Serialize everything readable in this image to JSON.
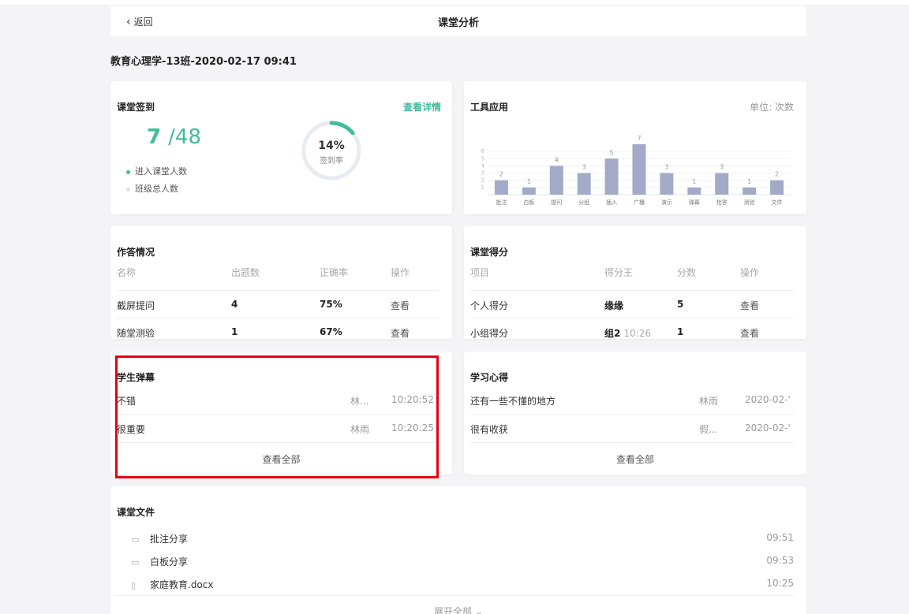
{
  "header": {
    "back_label": "返回",
    "title": "课堂分析"
  },
  "class_title": "教育心理学-13班-2020-02-17 09:41",
  "checkin": {
    "title": "课堂签到",
    "detail_link": "查看详情",
    "entered": "7",
    "total": "/48",
    "legend_entered": "进入课堂人数",
    "legend_total": "班级总人数",
    "rate": "14%",
    "rate_label": "签到率",
    "rate_fraction": 0.14,
    "colors": {
      "accent": "#3fbc9b",
      "track": "#e8ecf2"
    }
  },
  "tools": {
    "title": "工具应用",
    "unit": "单位: 次数",
    "chart_data": {
      "type": "bar",
      "categories": [
        "批注",
        "白板",
        "提问",
        "分组",
        "插入",
        "广播",
        "演示",
        "弹幕",
        "抢答",
        "测验",
        "文件"
      ],
      "values": [
        2,
        1,
        4,
        3,
        5,
        7,
        3,
        1,
        3,
        1,
        2
      ],
      "yticks": [
        1,
        2,
        3,
        4,
        5,
        6
      ],
      "ylim": [
        0,
        7
      ],
      "color": "#a3aac7",
      "grid": true
    }
  },
  "answers": {
    "title": "作答情况",
    "headers": [
      "名称",
      "出题数",
      "正确率",
      "操作"
    ],
    "rows": [
      {
        "name": "截屏提问",
        "count": "4",
        "rate": "75%",
        "op": "查看"
      },
      {
        "name": "随堂测验",
        "count": "1",
        "rate": "67%",
        "op": "查看"
      }
    ]
  },
  "scores": {
    "title": "课堂得分",
    "headers": [
      "项目",
      "得分王",
      "分数",
      "操作"
    ],
    "rows": [
      {
        "item": "个人得分",
        "king": "缘缘",
        "king_sub": "",
        "score": "5",
        "op": "查看"
      },
      {
        "item": "小组得分",
        "king": "组2",
        "king_sub": "10:26",
        "score": "1",
        "op": "查看"
      }
    ]
  },
  "danmaku": {
    "title": "学生弹幕",
    "rows": [
      {
        "text": "不错",
        "user": "林...",
        "time": "10:20:52"
      },
      {
        "text": "很重要",
        "user": "林雨",
        "time": "10:20:25"
      }
    ],
    "see_all": "查看全部"
  },
  "insights": {
    "title": "学习心得",
    "rows": [
      {
        "text": "还有一些不懂的地方",
        "user": "林雨",
        "date": "2020-02-'"
      },
      {
        "text": "很有收获",
        "user": "假...",
        "date": "2020-02-'"
      }
    ],
    "see_all": "查看全部"
  },
  "files": {
    "title": "课堂文件",
    "rows": [
      {
        "icon": "folder-icon",
        "name": "批注分享",
        "time": "09:51"
      },
      {
        "icon": "folder-icon",
        "name": "白板分享",
        "time": "09:53"
      },
      {
        "icon": "file-icon",
        "name": "家庭教育.docx",
        "time": "10:25"
      }
    ],
    "expand": "展开全部"
  }
}
